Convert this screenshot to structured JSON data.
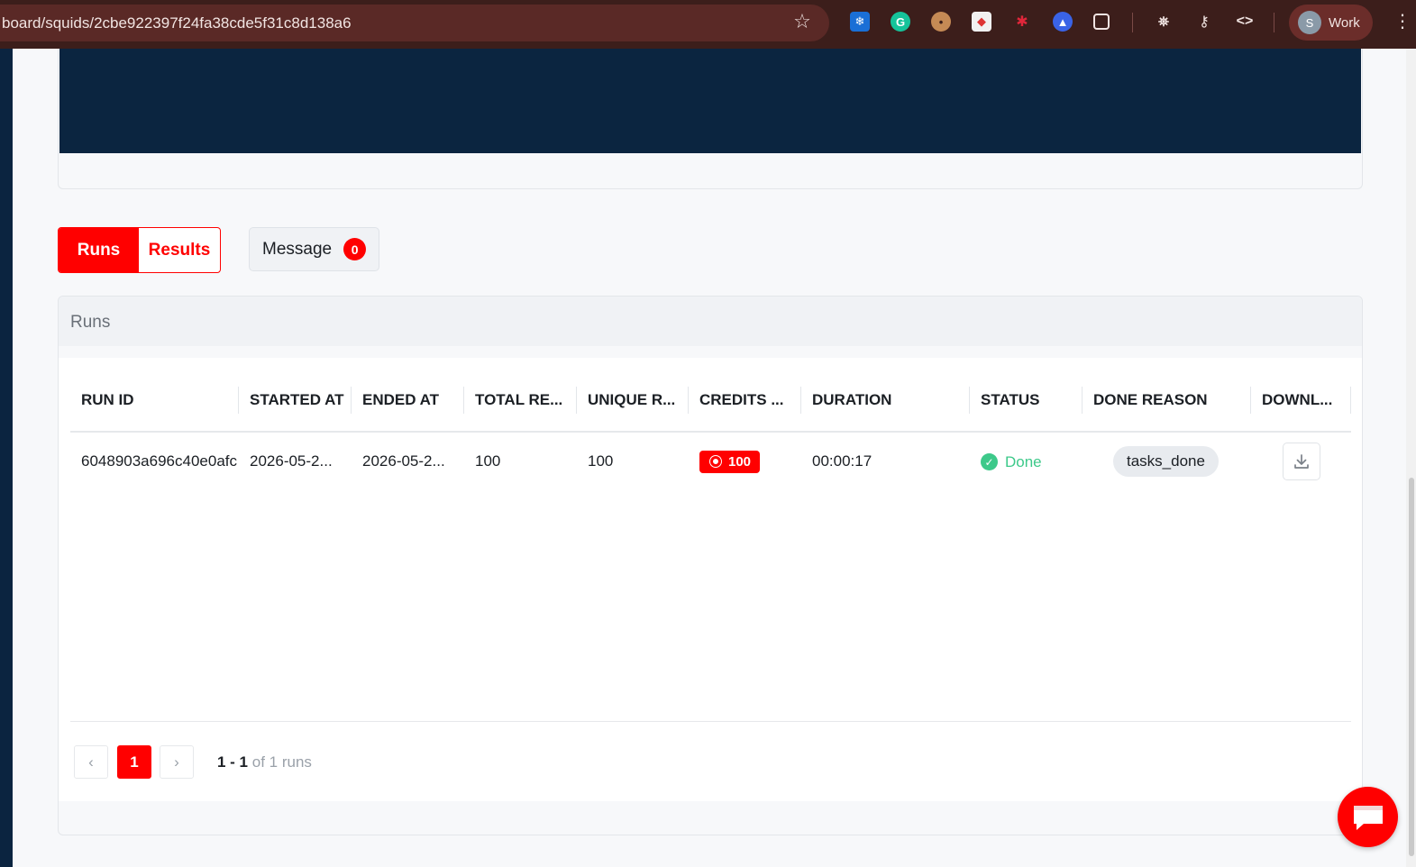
{
  "browser": {
    "url": "board/squids/2cbe922397f24fa38cde5f31c8d138a6",
    "profile_initial": "S",
    "profile_label": "Work"
  },
  "tabs": {
    "runs_label": "Runs",
    "results_label": "Results",
    "message_label": "Message",
    "message_count": "0"
  },
  "runs_panel": {
    "title": "Runs",
    "columns": [
      "RUN ID",
      "STARTED AT",
      "ENDED AT",
      "TOTAL RE...",
      "UNIQUE R...",
      "CREDITS ...",
      "DURATION",
      "STATUS",
      "DONE REASON",
      "DOWNL..."
    ],
    "rows": [
      {
        "run_id": "6048903a696c40e0afc",
        "started_at": "2026-05-2...",
        "ended_at": "2026-05-2...",
        "total_results": "100",
        "unique_results": "100",
        "credits": "100",
        "duration": "00:00:17",
        "status": "Done",
        "done_reason": "tasks_done"
      }
    ]
  },
  "pagination": {
    "current_page": "1",
    "range": "1 - 1",
    "total": "of 1 runs"
  },
  "colors": {
    "accent": "#ff0000",
    "banner": "#0b2540",
    "success": "#3dc98a"
  }
}
